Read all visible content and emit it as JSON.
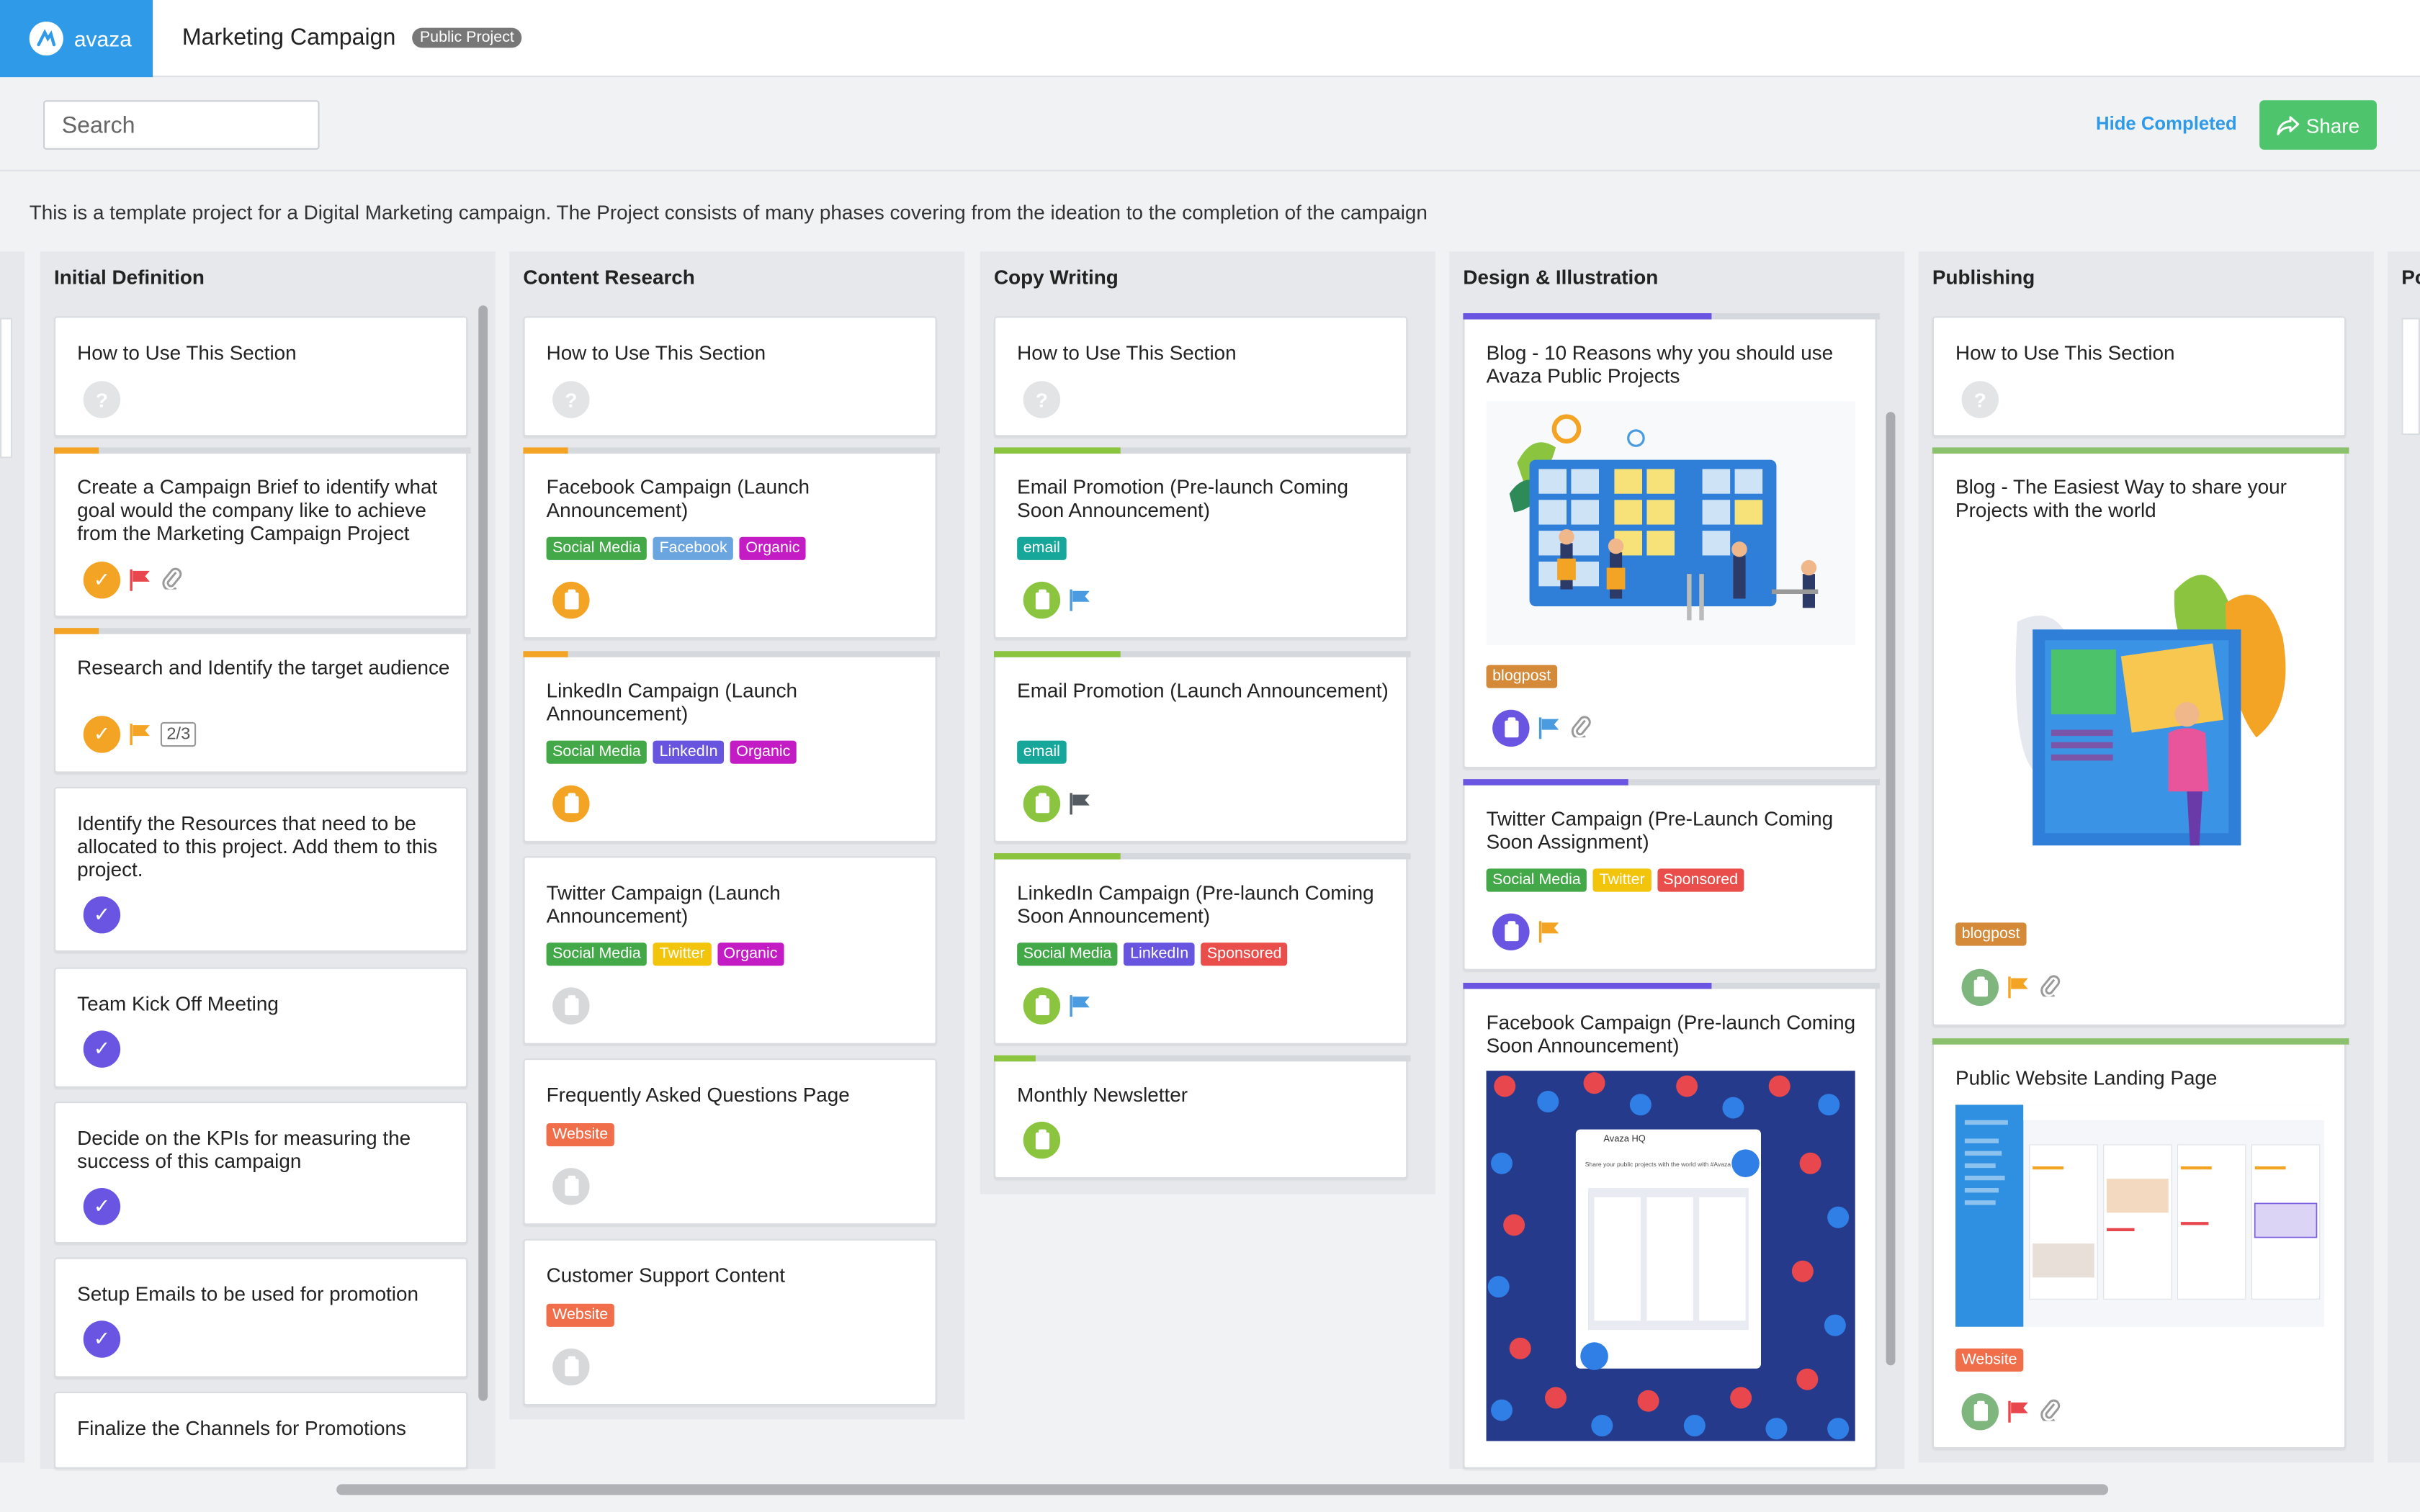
{
  "app": {
    "logo_text": "avaza",
    "project_title": "Marketing Campaign",
    "project_badge": "Public Project"
  },
  "toolbar": {
    "search_placeholder": "Search",
    "hide_completed": "Hide Completed",
    "share_label": "Share"
  },
  "description": "This is a template project for a Digital Marketing campaign. The Project consists of many phases covering from the ideation to the completion of the campaign",
  "colors": {
    "brand": "#2f9be8",
    "share": "#4ec46c",
    "orange": "#f4a424",
    "purple": "#6a55e2",
    "green": "#8bc540",
    "red": "#e8474d",
    "blue": "#4a9be0",
    "dark_flag": "#555b62"
  },
  "tag_colors": {
    "Social Media": "#43a847",
    "Facebook": "#6aa5e0",
    "Organic": "#c41cc4",
    "LinkedIn": "#6755e0",
    "Twitter": "#f2c40c",
    "email": "#17a69a",
    "Sponsored": "#ea4e4a",
    "Website": "#f06f4a",
    "blogpost": "#d58a3a"
  },
  "columns": [
    {
      "title": "Initial Definition",
      "cards": [
        {
          "title": "How to Use This Section",
          "icons": [
            "question-icon"
          ]
        },
        {
          "title": "Create a Campaign Brief to identify what goal would the company like to achieve from the Marketing Campaign Project",
          "icons": [
            "check-orange-icon",
            "red-flag-icon",
            "paperclip-icon"
          ]
        },
        {
          "title": "Research and Identify the target audience",
          "icons": [
            "check-orange-icon",
            "orange-flag-icon"
          ],
          "counter": "2/3"
        },
        {
          "title": "Identify the Resources that need to be allocated to this project. Add them to this project.",
          "icons": [
            "check-purple-icon"
          ]
        },
        {
          "title": "Team Kick Off Meeting",
          "icons": [
            "check-purple-icon"
          ]
        },
        {
          "title": "Decide on the KPIs for measuring the success of this campaign",
          "icons": [
            "check-purple-icon"
          ]
        },
        {
          "title": "Setup Emails to be used for promotion",
          "icons": [
            "check-purple-icon"
          ]
        },
        {
          "title": "Finalize the Channels for Promotions",
          "icons": []
        }
      ]
    },
    {
      "title": "Content Research",
      "cards": [
        {
          "title": "How to Use This Section",
          "icons": [
            "question-icon"
          ]
        },
        {
          "title": "Facebook Campaign (Launch Announcement)",
          "tags": [
            "Social Media",
            "Facebook",
            "Organic"
          ],
          "icons": [
            "clipboard-orange-icon"
          ]
        },
        {
          "title": "LinkedIn Campaign (Launch Announcement)",
          "tags": [
            "Social Media",
            "LinkedIn",
            "Organic"
          ],
          "icons": [
            "clipboard-orange-icon"
          ]
        },
        {
          "title": "Twitter Campaign (Launch Announcement)",
          "tags": [
            "Social Media",
            "Twitter",
            "Organic"
          ],
          "icons": [
            "clipboard-gray-icon"
          ]
        },
        {
          "title": "Frequently Asked Questions Page",
          "tags": [
            "Website"
          ],
          "icons": [
            "clipboard-gray-icon"
          ]
        },
        {
          "title": "Customer Support Content",
          "tags": [
            "Website"
          ],
          "icons": [
            "clipboard-gray-icon"
          ]
        }
      ]
    },
    {
      "title": "Copy Writing",
      "cards": [
        {
          "title": "How to Use This Section",
          "icons": [
            "question-icon"
          ]
        },
        {
          "title": "Email Promotion (Pre-launch Coming Soon Announcement)",
          "tags": [
            "email"
          ],
          "icons": [
            "clipboard-green-icon",
            "blue-flag-icon"
          ]
        },
        {
          "title": "Email Promotion (Launch Announcement)",
          "tags": [
            "email"
          ],
          "icons": [
            "clipboard-green-icon",
            "dark-flag-icon"
          ]
        },
        {
          "title": "LinkedIn Campaign (Pre-launch Coming Soon Announcement)",
          "tags": [
            "Social Media",
            "LinkedIn",
            "Sponsored"
          ],
          "icons": [
            "clipboard-green-icon",
            "blue-flag-icon"
          ]
        },
        {
          "title": "Monthly Newsletter",
          "icons": [
            "clipboard-green-icon"
          ]
        }
      ]
    },
    {
      "title": "Design & Illustration",
      "cards": [
        {
          "title": "Blog - 10 Reasons why you should use Avaza Public Projects",
          "tags": [
            "blogpost"
          ],
          "image": "kanban-team-illustration",
          "icons": [
            "clipboard-purple-icon",
            "blue-flag-icon",
            "paperclip-icon"
          ]
        },
        {
          "title": "Twitter Campaign (Pre-Launch Coming Soon Assignment)",
          "tags": [
            "Social Media",
            "Twitter",
            "Sponsored"
          ],
          "icons": [
            "clipboard-purple-icon",
            "orange-flag-icon"
          ]
        },
        {
          "title": "Facebook Campaign (Pre-launch Coming Soon Announcement)",
          "image": "facebook-reactions-image",
          "icons": [],
          "mock": {
            "header": "Avaza HQ",
            "line": "Share your public projects with the world with #Avaza"
          }
        }
      ]
    },
    {
      "title": "Publishing",
      "cards": [
        {
          "title": "How to Use This Section",
          "icons": [
            "question-icon"
          ]
        },
        {
          "title": "Blog - The Easiest Way to share your Projects with the world",
          "tags": [
            "blogpost"
          ],
          "image": "board-person-illustration",
          "icons": [
            "clipboard-lightgreen-icon",
            "orange-flag-icon",
            "paperclip-icon"
          ]
        },
        {
          "title": "Public Website Landing Page",
          "tags": [
            "Website"
          ],
          "image": "app-screenshot-image",
          "icons": [
            "clipboard-lightgreen-icon",
            "red-flag-icon",
            "paperclip-icon"
          ]
        }
      ]
    },
    {
      "title": "Po",
      "cards": []
    }
  ]
}
